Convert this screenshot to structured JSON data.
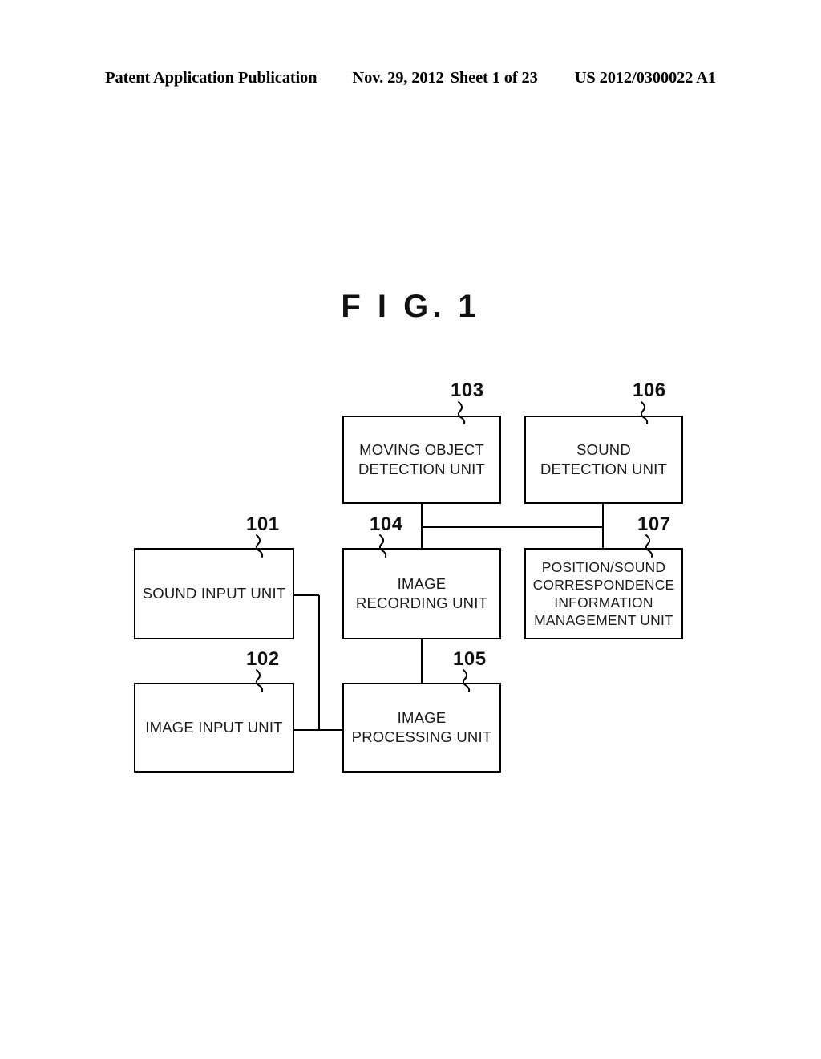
{
  "header": {
    "publication": "Patent Application Publication",
    "date": "Nov. 29, 2012",
    "sheet": "Sheet 1 of 23",
    "document_number": "US 2012/0300022 A1"
  },
  "figure": {
    "title": "F I G.  1",
    "caption_plain": "FIG. 1"
  },
  "diagram": {
    "type": "block-diagram",
    "nodes": [
      {
        "ref": "101",
        "label": "SOUND INPUT UNIT"
      },
      {
        "ref": "102",
        "label": "IMAGE INPUT UNIT"
      },
      {
        "ref": "103",
        "label": "MOVING OBJECT\nDETECTION UNIT"
      },
      {
        "ref": "104",
        "label": "IMAGE\nRECORDING UNIT"
      },
      {
        "ref": "105",
        "label": "IMAGE\nPROCESSING UNIT"
      },
      {
        "ref": "106",
        "label": "SOUND\nDETECTION UNIT"
      },
      {
        "ref": "107",
        "label": "POSITION/SOUND\nCORRESPONDENCE\nINFORMATION\nMANAGEMENT UNIT"
      }
    ],
    "connections": [
      {
        "from": "103",
        "to": "104"
      },
      {
        "from": "106",
        "to": "107"
      },
      {
        "from": "104",
        "to": "107"
      },
      {
        "from": "104",
        "to": "105"
      },
      {
        "from": "101",
        "to": "105"
      },
      {
        "from": "102",
        "to": "105"
      }
    ],
    "line_color": "#000000"
  }
}
